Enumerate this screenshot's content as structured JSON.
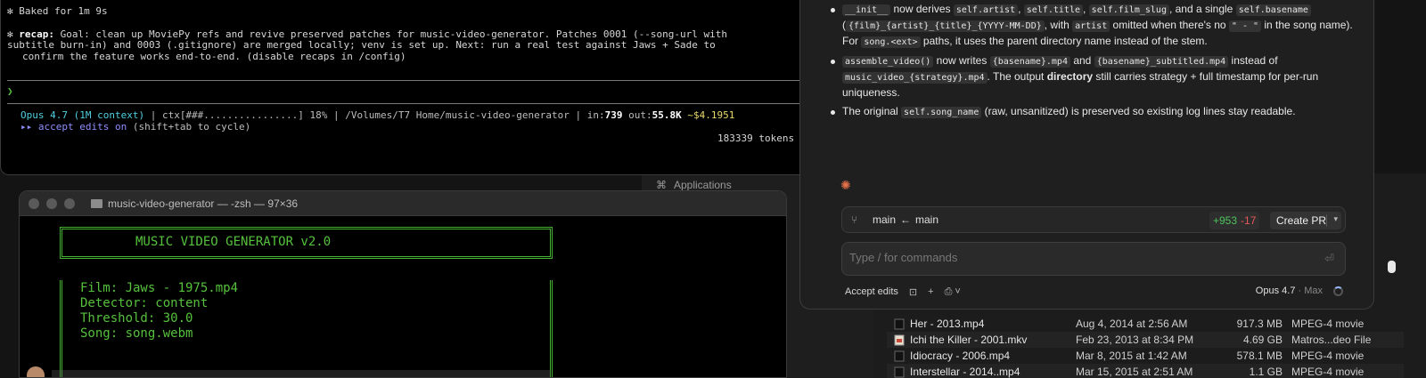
{
  "desktop": {
    "apps_label": "Applications",
    "files": [
      {
        "name": "Her - 2013.mp4",
        "date": "Aug 4, 2014 at 2:56 AM",
        "size": "917.3 MB",
        "kind": "MPEG-4 movie"
      },
      {
        "name": "Ichi the Killer - 2001.mkv",
        "date": "Feb 23, 2013 at 8:34 PM",
        "size": "4.69 GB",
        "kind": "Matros...deo File"
      },
      {
        "name": "Idiocracy - 2006.mp4",
        "date": "Mar 8, 2015 at 1:42 AM",
        "size": "578.1 MB",
        "kind": "MPEG-4 movie"
      },
      {
        "name": "Interstellar - 2014..mp4",
        "date": "Mar 15, 2015 at 2:51 AM",
        "size": "1.1 GB",
        "kind": "MPEG-4 movie"
      }
    ]
  },
  "term_top": {
    "baked": "✻ Baked for 1m 9s",
    "recap_label": "recap:",
    "recap_line1": " Goal: clean up MoviePy refs and revive preserved patches for music-video-generator. Patches 0001 (--song-url with",
    "recap_line2": "subtitle burn-in) and 0003 (.gitignore) are merged locally; venv is set up. Next: run a real test against Jaws + Sade to",
    "recap_line3": "confirm the feature works end-to-end. (disable recaps in /config)",
    "prompt": "❯",
    "status_model": "Opus 4.7 (1M context)",
    "status_ctx": " | ctx[###................] 18% | /Volumes/T7 Home/music-video-generator | ",
    "status_in_label": "in:",
    "status_in": "739",
    "status_out_label": " out:",
    "status_out": "55.8K",
    "status_cost": " ~$4.1951",
    "accept_prefix": "▸▸ ",
    "accept_label": "accept edits on",
    "accept_hint": " (shift+tab to cycle)",
    "tokens": "183339 tokens"
  },
  "term_bottom": {
    "title": "music-video-generator — -zsh — 97×36",
    "banner": "MUSIC VIDEO GENERATOR v2.0",
    "film": "Film: Jaws - 1975.mp4",
    "detector": "Detector: content",
    "threshold": "Threshold: 30.0",
    "song": "Song: song.webm"
  },
  "claude": {
    "b1": {
      "c1": "__init__",
      "t1": " now derives ",
      "c2": "self.artist",
      "t2": ", ",
      "c3": "self.title",
      "t3": ", ",
      "c4": "self.film_slug",
      "t4": ", and a single ",
      "c5": "self.basename",
      "t5": " (",
      "c6": "{film}_{artist}_{title}_{YYYY-MM-DD}",
      "t6": ", with ",
      "c7": "artist",
      "t7": " omitted when there's no ",
      "c8": "\" - \"",
      "t8": " in the song name). For ",
      "c9": "song.<ext>",
      "t9": " paths, it uses the parent directory name instead of the stem."
    },
    "b2": {
      "c1": "assemble_video()",
      "t1": " now writes ",
      "c2": "{basename}.mp4",
      "t2": " and ",
      "c3": "{basename}_subtitled.mp4",
      "t3": " instead of ",
      "c4": "music_video_{strategy}.mp4",
      "t4": ". The output ",
      "t5": "directory",
      "t6": " still carries strategy + full timestamp for per-run uniqueness."
    },
    "b3": {
      "t1": "The original ",
      "c1": "self.song_name",
      "t2": " (raw, unsanitized) is preserved so existing log lines stay readable."
    },
    "branch_from": "main",
    "branch_arrow": "←",
    "branch_to": "main",
    "diff_plus": "+953",
    "diff_minus": "-17",
    "create_pr": "Create PR",
    "input_placeholder": "Type / for commands",
    "accept_edits": "Accept edits",
    "model": "Opus 4.7",
    "model_suffix": " · Max"
  }
}
